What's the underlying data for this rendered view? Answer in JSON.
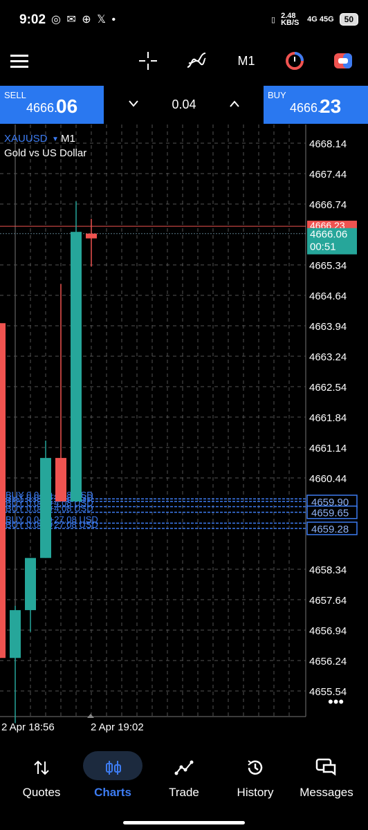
{
  "status_bar": {
    "time": "9:02",
    "notifications": "◎ ✉ ⊕ 𝕏 •",
    "net_speed": "2.48 KB/S",
    "signal": "4G 45G",
    "battery": "50"
  },
  "toolbar": {
    "timeframe": "M1"
  },
  "trade": {
    "sell_label": "SELL",
    "sell_price_small": "4666.",
    "sell_price_big": "06",
    "buy_label": "BUY",
    "buy_price_small": "4666.",
    "buy_price_big": "23",
    "volume": "0.04"
  },
  "chart": {
    "symbol": "XAUUSD",
    "timeframe": "M1",
    "description": "Gold vs US Dollar",
    "price_labels": [
      "4668.14",
      "4667.44",
      "4666.74",
      "4665.34",
      "4664.64",
      "4663.94",
      "4663.24",
      "4662.54",
      "4661.84",
      "4661.14",
      "4660.44",
      "4658.34",
      "4657.64",
      "4656.94",
      "4656.24",
      "4655.54"
    ],
    "ask_tag": "4666.23",
    "bid_tag": "4666.06",
    "countdown": "00:51",
    "position_tags": [
      "4659.90",
      "4659.65",
      "4659.28"
    ],
    "time_labels": [
      "2 Apr 18:56",
      "2 Apr 19:02"
    ],
    "position_lines": [
      {
        "text": "BUY 0.04, +4.08 USD"
      },
      {
        "text": "BUY 0.04, +4.08 USD"
      },
      {
        "text": "BUY 0.04, +4.08 USD"
      },
      {
        "text": "BUY 0.04, +4.08 USD"
      },
      {
        "text": "BUY 0.04, +27.08 USD"
      },
      {
        "text": "BUY 0.04, +27.08 USD"
      }
    ],
    "colors": {
      "up": "#26a69a",
      "down": "#ef5350",
      "ask": "#ef5350",
      "bid": "#5a7a8a",
      "position": "#3d7cf2",
      "grid": "#555555"
    }
  },
  "chart_data": {
    "type": "candlestick",
    "symbol": "XAUUSD",
    "timeframe": "M1",
    "candles": [
      {
        "time": "18:56",
        "open": 4664.0,
        "high": 4664.0,
        "low": 4656.3,
        "close": 4656.3
      },
      {
        "time": "18:57",
        "open": 4656.3,
        "high": 4657.5,
        "low": 4654.8,
        "close": 4657.4
      },
      {
        "time": "18:58",
        "open": 4657.4,
        "high": 4658.6,
        "low": 4656.9,
        "close": 4658.6
      },
      {
        "time": "18:59",
        "open": 4658.6,
        "high": 4661.3,
        "low": 4658.6,
        "close": 4660.9
      },
      {
        "time": "19:00",
        "open": 4660.9,
        "high": 4664.9,
        "low": 4659.9,
        "close": 4659.9
      },
      {
        "time": "19:01",
        "open": 4659.9,
        "high": 4666.8,
        "low": 4659.9,
        "close": 4666.1
      },
      {
        "time": "19:02",
        "open": 4666.06,
        "high": 4666.4,
        "low": 4665.3,
        "close": 4665.95
      }
    ],
    "ylim": [
      4655.0,
      4668.6
    ]
  },
  "nav": [
    {
      "label": "Quotes",
      "icon": "quotes-icon"
    },
    {
      "label": "Charts",
      "icon": "charts-icon"
    },
    {
      "label": "Trade",
      "icon": "trade-icon"
    },
    {
      "label": "History",
      "icon": "history-icon"
    },
    {
      "label": "Messages",
      "icon": "messages-icon"
    }
  ]
}
